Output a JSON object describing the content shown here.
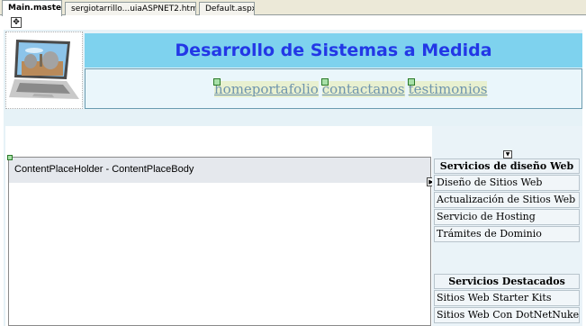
{
  "tabs": [
    {
      "label": "Main.master",
      "active": true
    },
    {
      "label": "sergiotarrillo...uiaASPNET2.htm",
      "active": false
    },
    {
      "label": "Default.aspx",
      "active": false
    }
  ],
  "header": {
    "title": "Desarrollo de Sistemas a Medida",
    "logo_icon": "laptop-photo"
  },
  "menu": {
    "items": [
      {
        "label": "home"
      },
      {
        "label": "portafolio"
      },
      {
        "label": "contactanos"
      },
      {
        "label": "testimonios"
      }
    ]
  },
  "content": {
    "placeholder_label": "ContentPlaceHolder - ContentPlaceBody"
  },
  "sidebar": {
    "sections": [
      {
        "title": "Servicios de diseño Web",
        "items": [
          {
            "label": "Diseño de Sitios Web"
          },
          {
            "label": "Actualización de Sitios Web"
          },
          {
            "label": "Servicio de Hosting"
          },
          {
            "label": "Trámites de Dominio"
          }
        ]
      },
      {
        "title": "Servicios Destacados",
        "items": [
          {
            "label": "Sitios Web Starter Kits"
          },
          {
            "label": "Sitios Web Con DotNetNuke"
          }
        ]
      }
    ]
  },
  "colors": {
    "title_text": "#2337e6",
    "title_bg": "#7ed2ee",
    "page_bg": "#e6f2f7",
    "link": "#6e94ad"
  }
}
